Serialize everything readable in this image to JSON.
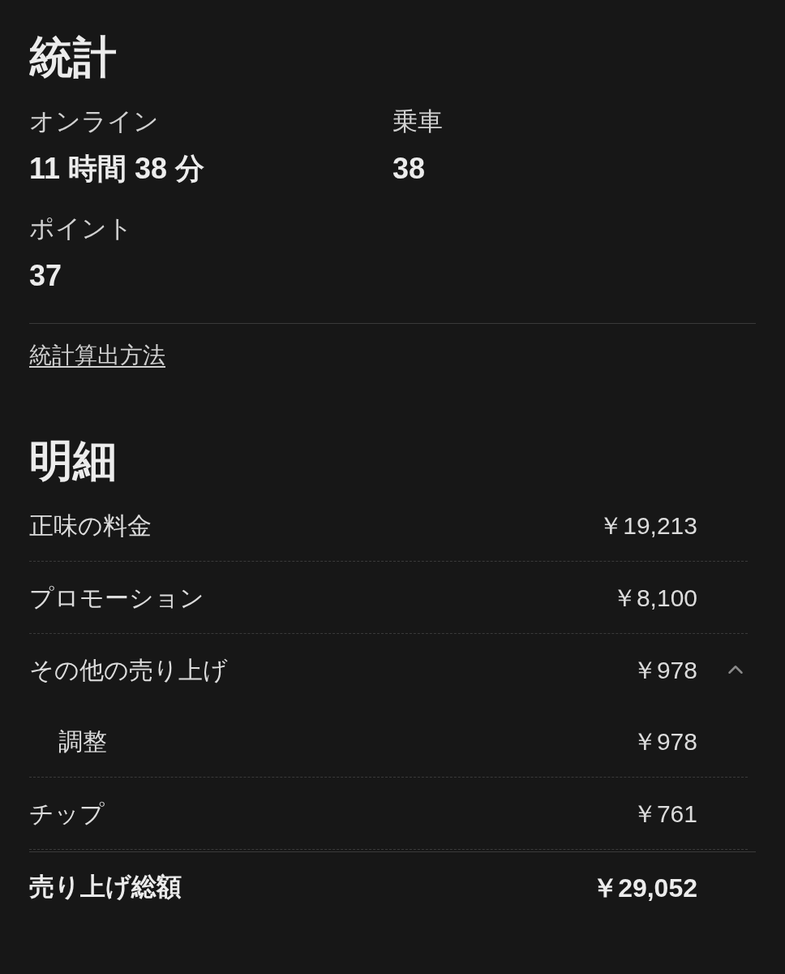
{
  "stats": {
    "title": "統計",
    "items": [
      {
        "label": "オンライン",
        "value": "11 時間 38 分"
      },
      {
        "label": "乗車",
        "value": "38"
      },
      {
        "label": "ポイント",
        "value": "37"
      }
    ],
    "link": "統計算出方法"
  },
  "breakdown": {
    "title": "明細",
    "rows": [
      {
        "label": "正味の料金",
        "amount": "￥19,213"
      },
      {
        "label": "プロモーション",
        "amount": "￥8,100"
      },
      {
        "label": "その他の売り上げ",
        "amount": "￥978",
        "expanded": true,
        "children": [
          {
            "label": "調整",
            "amount": "￥978"
          }
        ]
      },
      {
        "label": "チップ",
        "amount": "￥761"
      }
    ],
    "total": {
      "label": "売り上げ総額",
      "amount": "￥29,052"
    }
  }
}
